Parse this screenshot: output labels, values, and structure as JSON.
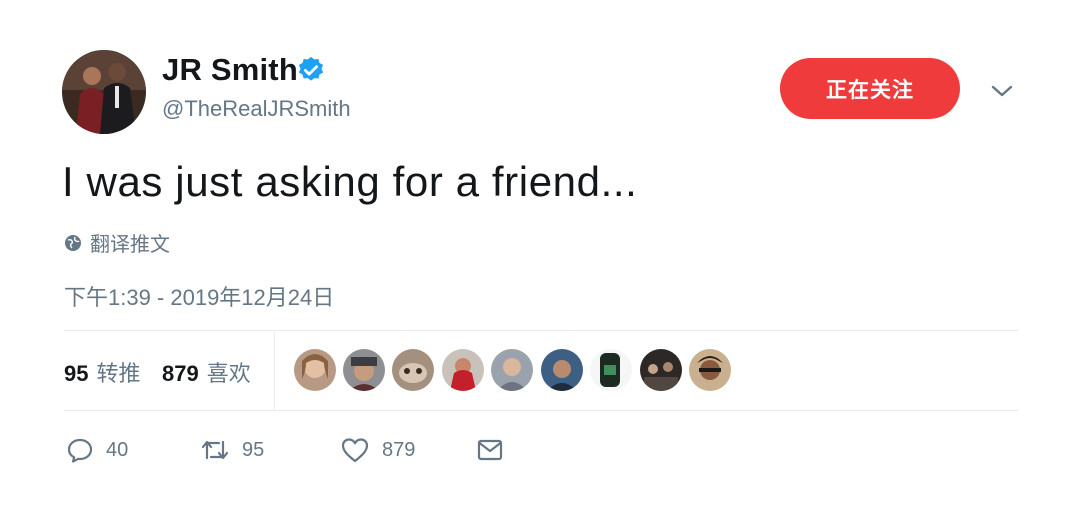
{
  "user": {
    "name": "JR Smith",
    "handle": "@TheRealJRSmith",
    "verified": true
  },
  "follow_button": {
    "label": "正在关注"
  },
  "tweet": {
    "text": "I was just asking for a friend...",
    "translate_label": "翻译推文",
    "timestamp": "下午1:39 - 2019年12月24日"
  },
  "stats": {
    "retweets_count": "95",
    "retweets_label": "转推",
    "likes_count": "879",
    "likes_label": "喜欢"
  },
  "liker_avatars": 9,
  "actions": {
    "reply_count": "40",
    "retweet_count": "95",
    "like_count": "879"
  },
  "colors": {
    "follow_button": "#ef3b3b",
    "verified": "#1da1f2",
    "secondary_text": "#657786"
  },
  "icons": [
    "globe-icon",
    "verified-badge-icon",
    "chevron-down-icon",
    "reply-icon",
    "retweet-icon",
    "heart-icon",
    "mail-icon"
  ]
}
